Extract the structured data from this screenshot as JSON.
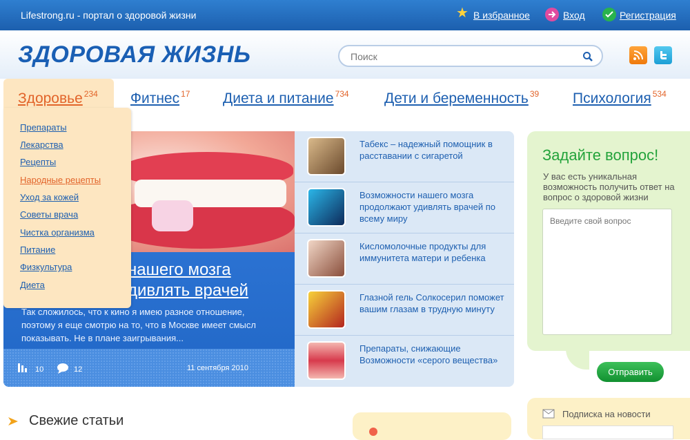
{
  "topbar": {
    "site": "Lifestrong.ru - портал о здоровой жизни",
    "favorites": "В избранное",
    "login": "Вход",
    "register": "Регистрация"
  },
  "header": {
    "logo": "ЗДОРОВАЯ ЖИЗНЬ",
    "search_placeholder": "Поиск"
  },
  "nav": [
    {
      "label": "Здоровье",
      "count": "234",
      "active": true
    },
    {
      "label": "Фитнес",
      "count": "17"
    },
    {
      "label": "Диета и питание",
      "count": "734"
    },
    {
      "label": "Дети и беременность",
      "count": "39"
    },
    {
      "label": "Психология",
      "count": "534"
    }
  ],
  "dropdown": [
    "Препараты",
    "Лекарства",
    "Рецепты",
    "Народные рецепты",
    "Уход за кожей",
    "Советы врача",
    "Чистка организма",
    "Питание",
    "Физкультура",
    "Диета"
  ],
  "feature": {
    "title_line1": "нашего мозга",
    "title_line2": "дивлять врачей",
    "text": "Так сложилось, что к кино я имею разное отношение, поэтому я еще смотрю на то, что в Москве имеет смысл показывать. Не в плане заигрывания...",
    "views": "10",
    "comments": "12",
    "date": "11 сентября 2010"
  },
  "articles": [
    "Табекс – надежный помощник в расставании с сигаретой",
    "Возможности нашего мозга продолжают удивлять врачей по всему миру",
    "Кисломолочные продукты для иммунитета матери и ребенка",
    "Глазной гель Солкосерил поможет вашим глазам в трудную минуту",
    "Препараты, снижающие Возможности «серого вещества»"
  ],
  "ask": {
    "title": "Задайте вопрос!",
    "text": "У вас есть уникальная возможность получить ответ на вопрос о здоровой жизни",
    "placeholder": "Введите свой вопрос",
    "send": "Отправить"
  },
  "bottom": {
    "fresh": "Свежие статьи",
    "subscribe": "Подписка на новости"
  },
  "colors": {
    "topbar": "#1c5fae",
    "link": "#1d5fb0",
    "accent": "#e2642a",
    "dropdown_bg": "#fde6c1",
    "ask_bg": "#e4f4cf",
    "green": "#23a33b"
  }
}
